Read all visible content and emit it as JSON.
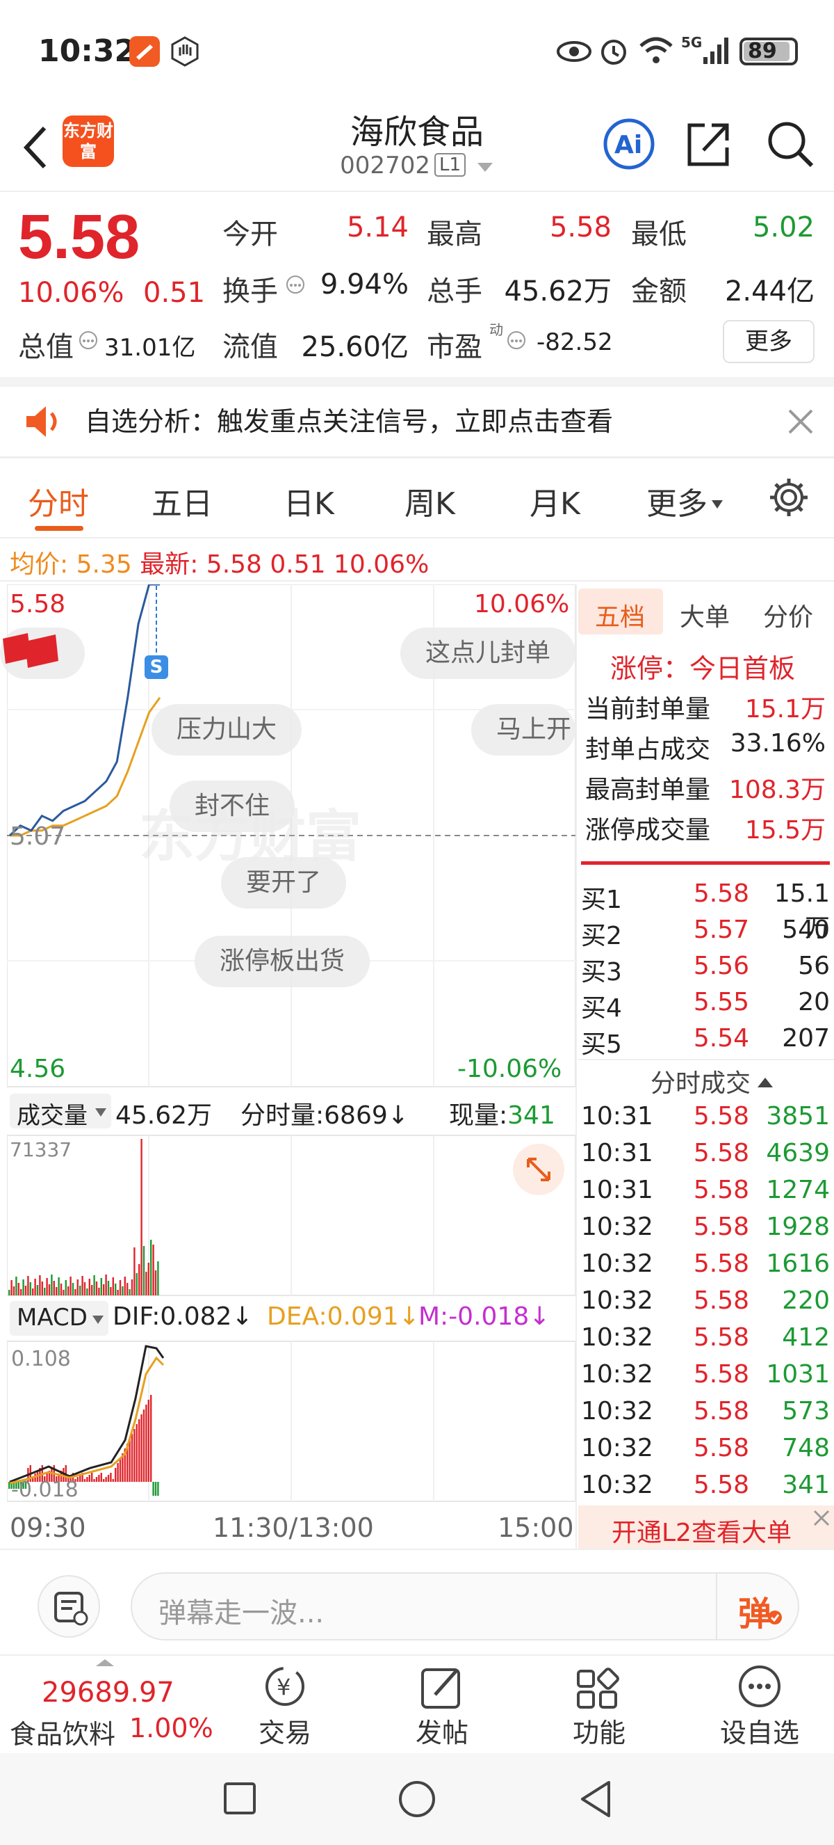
{
  "status": {
    "time": "10:32",
    "battery": "89"
  },
  "header": {
    "logo": "东方财富",
    "stock_name": "海欣食品",
    "stock_code": "002702",
    "level": "L1"
  },
  "quote": {
    "price": "5.58",
    "change_pct": "10.06%",
    "change": "0.51",
    "open_lbl": "今开",
    "open": "5.14",
    "high_lbl": "最高",
    "high": "5.58",
    "low_lbl": "最低",
    "low": "5.02",
    "turnover_lbl": "换手",
    "turnover": "9.94%",
    "volume_lbl": "总手",
    "volume": "45.62万",
    "amount_lbl": "金额",
    "amount": "2.44亿",
    "mktcap_lbl": "总值",
    "mktcap": "31.01亿",
    "float_lbl": "流值",
    "float": "25.60亿",
    "pe_lbl": "市盈",
    "pe_sup": "动",
    "pe": "-82.52",
    "more": "更多"
  },
  "notice": {
    "text": "自选分析：触发重点关注信号，立即点击查看"
  },
  "tabs": [
    "分时",
    "五日",
    "日K",
    "周K",
    "月K",
    "更多"
  ],
  "infoline": {
    "avg_lbl": "均价:",
    "avg": "5.35",
    "latest_lbl": "最新:",
    "latest": "5.58",
    "chg": "0.51",
    "pct": "10.06%"
  },
  "chart": {
    "price_top": "5.58",
    "pct_top": "10.06%",
    "price_mid": "5.07",
    "price_bottom": "4.56",
    "pct_bottom": "-10.06%",
    "watermark": "东方财富",
    "s_mark": "S",
    "danmu": [
      "这点儿封单",
      "压力山大",
      "马上开",
      "封不住",
      "要开了",
      "涨停板出货"
    ],
    "vol_lbl": "成交量",
    "vol_total": "45.62万",
    "vol_tick_lbl": "分时量:6869↓",
    "vol_now_lbl": "现量:",
    "vol_now": "341",
    "vol_max": "71337",
    "macd_lbl": "MACD",
    "dif": "DIF:0.082↓",
    "dea": "DEA:0.091↓",
    "m": "M:-0.018↓",
    "macd_top": "0.108",
    "macd_bottom": "-0.018",
    "time_start": "09:30",
    "time_mid": "11:30/13:00",
    "time_end": "15:00"
  },
  "chart_data": {
    "type": "line",
    "x": [
      "09:30",
      "09:35",
      "09:40",
      "09:45",
      "09:50",
      "09:55",
      "10:00",
      "10:05",
      "10:10",
      "10:15",
      "10:20",
      "10:25",
      "10:28",
      "10:31",
      "10:32"
    ],
    "series": [
      {
        "name": "最新",
        "values": [
          5.07,
          5.09,
          5.08,
          5.11,
          5.1,
          5.12,
          5.13,
          5.14,
          5.16,
          5.18,
          5.22,
          5.35,
          5.5,
          5.58,
          5.58
        ]
      },
      {
        "name": "均价",
        "values": [
          5.07,
          5.07,
          5.08,
          5.08,
          5.09,
          5.09,
          5.1,
          5.11,
          5.12,
          5.13,
          5.15,
          5.2,
          5.26,
          5.32,
          5.35
        ]
      }
    ],
    "ylim": [
      4.56,
      5.58
    ]
  },
  "right_panel": {
    "tabs": [
      "五档",
      "大单",
      "分价"
    ],
    "limit_lbl": "涨停：今日首板",
    "stats": [
      {
        "lbl": "当前封单量",
        "val": "15.1万"
      },
      {
        "lbl": "封单占成交",
        "val": "33.16%"
      },
      {
        "lbl": "最高封单量",
        "val": "108.3万"
      },
      {
        "lbl": "涨停成交量",
        "val": "15.5万"
      }
    ],
    "book": [
      {
        "lbl": "买1",
        "price": "5.58",
        "qty": "15.1万"
      },
      {
        "lbl": "买2",
        "price": "5.57",
        "qty": "540"
      },
      {
        "lbl": "买3",
        "price": "5.56",
        "qty": "56"
      },
      {
        "lbl": "买4",
        "price": "5.55",
        "qty": "20"
      },
      {
        "lbl": "买5",
        "price": "5.54",
        "qty": "207"
      }
    ],
    "ticks_lbl": "分时成交",
    "ticks": [
      {
        "t": "10:31",
        "p": "5.58",
        "v": "3851"
      },
      {
        "t": "10:31",
        "p": "5.58",
        "v": "4639"
      },
      {
        "t": "10:31",
        "p": "5.58",
        "v": "1274"
      },
      {
        "t": "10:32",
        "p": "5.58",
        "v": "1928"
      },
      {
        "t": "10:32",
        "p": "5.58",
        "v": "1616"
      },
      {
        "t": "10:32",
        "p": "5.58",
        "v": "220"
      },
      {
        "t": "10:32",
        "p": "5.58",
        "v": "412"
      },
      {
        "t": "10:32",
        "p": "5.58",
        "v": "1031"
      },
      {
        "t": "10:32",
        "p": "5.58",
        "v": "573"
      },
      {
        "t": "10:32",
        "p": "5.58",
        "v": "748"
      },
      {
        "t": "10:32",
        "p": "5.58",
        "v": "341"
      }
    ],
    "l2_promo": "开通L2查看大单"
  },
  "comment": {
    "placeholder": "弹幕走一波...",
    "send": "弹"
  },
  "bottom_nav": {
    "index_value": "29689.97",
    "index_name": "食品饮料",
    "index_pct": "1.00%",
    "items": [
      "交易",
      "发帖",
      "功能",
      "设自选"
    ]
  },
  "colors": {
    "up": "#e0242b",
    "down": "#1c9a33",
    "accent": "#e85d1c",
    "price_line": "#2a5a9c",
    "avg_line": "#e6a020"
  }
}
